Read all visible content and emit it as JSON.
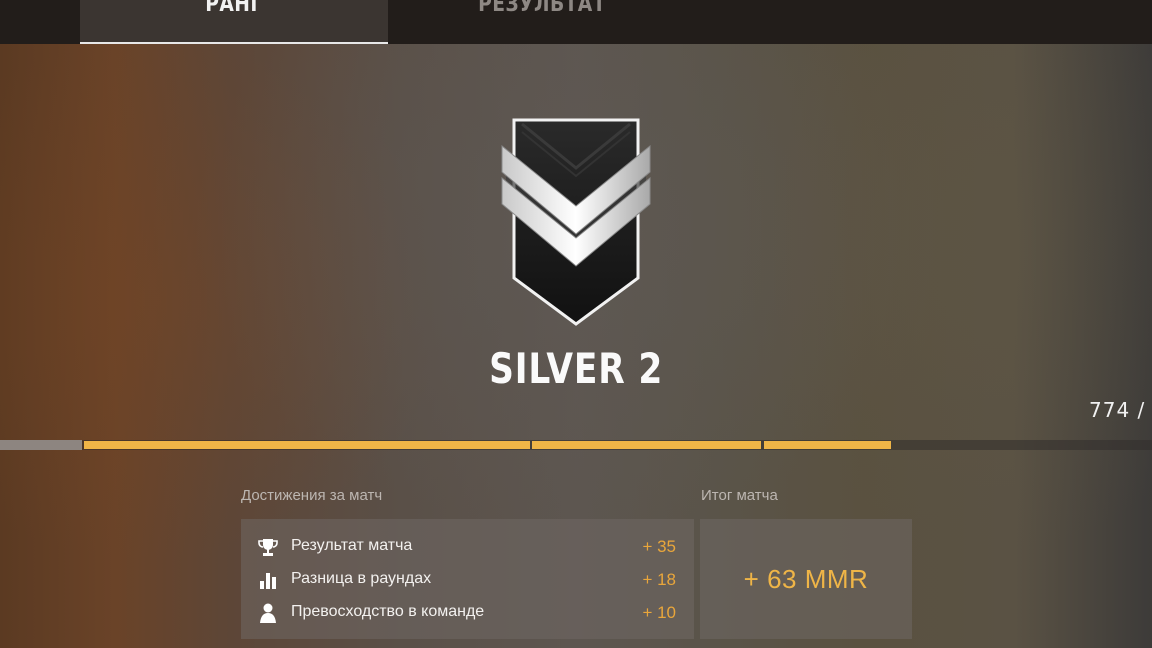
{
  "tabs": {
    "rank": "РАНГ",
    "result": "РЕЗУЛЬТАТ"
  },
  "rank": {
    "name": "SILVER 2",
    "mmr_counter": "774 /"
  },
  "progress": {
    "segments_fill": [
      1,
      1,
      1
    ]
  },
  "achievements": {
    "title": "Достижения за матч",
    "items": [
      {
        "label": "Результат матча",
        "points": "+ 35",
        "icon": "trophy-icon"
      },
      {
        "label": "Разница в раундах",
        "points": "+ 18",
        "icon": "bar-chart-icon"
      },
      {
        "label": "Превосходство в команде",
        "points": "+ 10",
        "icon": "person-icon"
      }
    ]
  },
  "total": {
    "title": "Итог матча",
    "value": "+ 63 MMR"
  },
  "colors": {
    "accent": "#efb547",
    "points": "#e9a63b"
  }
}
